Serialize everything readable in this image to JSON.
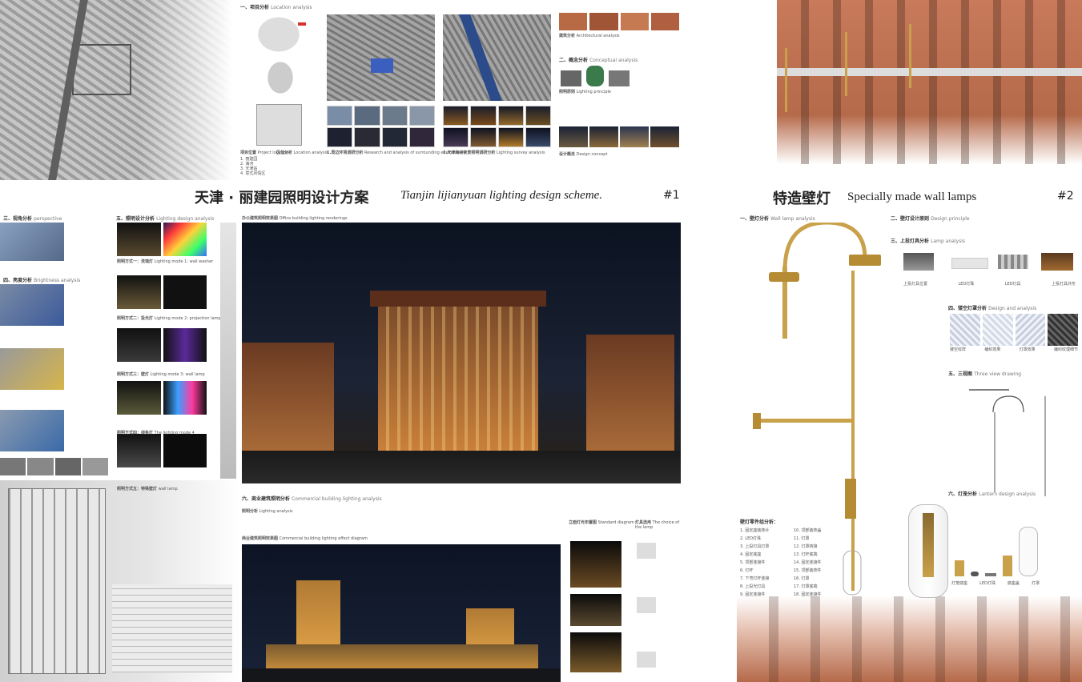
{
  "board1": {
    "title_cn": "天津 · 丽建园照明设计方案",
    "title_en": "Tianjin lijianyuan lighting design scheme.",
    "number": "#1",
    "sec1": "一、项目分析",
    "sec1_en": "Location analysis",
    "sec2": "二、概念分析",
    "sec2_en": "Conceptual analysis",
    "building_analysis": "建筑分析",
    "building_analysis_en": "Architectural analysis",
    "lighting_principle": "照明原则",
    "lighting_principle_en": "Lighting principle",
    "design_concept": "设计概念",
    "design_concept_en": "Design concept",
    "site_location": "项目位置",
    "site_location_en": "Project location",
    "location_analysis": "区位分析",
    "location_analysis_en": "Location analysis",
    "env_research": "1.周边环境调研分析",
    "env_research_en": "Research and analysis of surrounding environment",
    "lighting_research": "2.天津海河夜景照明调研分析",
    "lighting_research_en": "Lighting survey analysis",
    "map_legend": [
      "1. 丽建园",
      "2. 海河",
      "3. 天津站",
      "4. 意式风情区"
    ],
    "sec3": "三、视角分析",
    "sec3_en": "perspective",
    "sec4": "四、亮度分析",
    "sec4_en": "Brightness analysis",
    "sec5": "五、照明设计分析",
    "sec5_en": "Lighting design analysis",
    "sec6": "六、商业建筑照明分析",
    "sec6_en": "Commercial building lighting analysis",
    "office_rendering": "办公建筑照明效果图",
    "office_rendering_en": "Office building lighting renderings",
    "lighting_analysis": "照明分析",
    "lighting_analysis_en": "Lighting analysis",
    "commercial_rendering": "商业建筑照明效果图",
    "commercial_rendering_en": "Commercial building lighting effect diagram",
    "standard_lamp": "立面灯光布置图",
    "standard_lamp_en": "Standard diagram",
    "elevation_annot": "灯具选用",
    "elevation_annot_en": "The choice of the lamp",
    "method1": "照明方式一：洗墙灯",
    "method1_en": "Lighting mode 1: wall washer",
    "method2": "照明方式二：投光灯",
    "method2_en": "Lighting mode 2: projection lamp",
    "method3": "照明方式三：壁灯",
    "method3_en": "Lighting mode 3: wall lamp",
    "method4": "照明方式四：线条灯",
    "method4_en": "The lighting mode 4",
    "method5": "照明方式五：特殊壁灯",
    "method5_en": "wall lamp"
  },
  "board2": {
    "title_cn": "特造壁灯",
    "title_en": "Specially made wall lamps",
    "number": "#2",
    "sec1": "一、壁灯分析",
    "sec1_en": "Wall lamp analysis",
    "sec2": "二、壁灯设计原则",
    "sec2_en": "Design principle",
    "sec3": "三、上投灯具分析",
    "sec3_en": "Lamp analysis",
    "sec4": "四、镂空灯罩分析",
    "sec4_en": "Design and analysis",
    "sec5": "五、三视图",
    "sec5_en": "Three view drawing",
    "sec6": "六、灯笼分析",
    "sec6_en": "Lantern design analysis",
    "parts_title": "壁灯零件组分析：",
    "parts": [
      "1. 固定座装饰片",
      "2. LED灯珠",
      "3. 上投灯具灯罩",
      "4. 固定底座",
      "5. 顶部连接件",
      "6. 灯杆",
      "7. 下弯灯杆连接",
      "8. 上投光灯具",
      "9. 固定连接件",
      "10. 顶部装饰盖",
      "11. 灯罩",
      "12. 灯罩转接",
      "13. 灯杆底端",
      "14. 固定连接件",
      "15. 顶部装饰件",
      "16. 灯罩",
      "17. 灯罩底端",
      "18. 固定连接件"
    ],
    "lamp_labels": [
      "上投灯具位置",
      "LED灯珠",
      "LED灯具",
      "上投灯具外形"
    ],
    "shade_labels": [
      "镂空纹样",
      "编织效果",
      "灯罩效果",
      "编织纹理细节"
    ],
    "lantern_labels": [
      "灯笼底座",
      "LED灯珠",
      "底座盖",
      "灯罩"
    ]
  },
  "colors": {
    "gold": "#c9a14a",
    "night": "#0b1220",
    "warm": "#e8b14a",
    "red": "#d9302c"
  }
}
